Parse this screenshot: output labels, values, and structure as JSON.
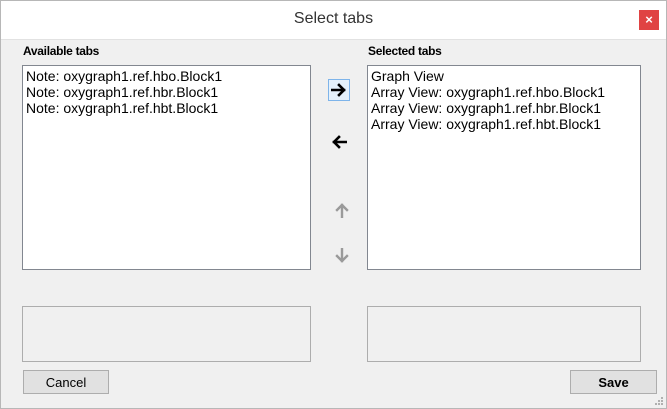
{
  "window": {
    "title": "Select tabs",
    "close_glyph": "×"
  },
  "available": {
    "label": "Available tabs",
    "items": [
      "Note: oxygraph1.ref.hbo.Block1",
      "Note: oxygraph1.ref.hbr.Block1",
      "Note: oxygraph1.ref.hbt.Block1"
    ]
  },
  "selected": {
    "label": "Selected tabs",
    "items": [
      "Graph View",
      "Array View: oxygraph1.ref.hbo.Block1",
      "Array View: oxygraph1.ref.hbr.Block1",
      "Array View: oxygraph1.ref.hbt.Block1"
    ]
  },
  "buttons": {
    "cancel_label": "Cancel",
    "save_label": "Save"
  },
  "icons": {
    "add": "arrow-right-icon",
    "remove": "arrow-left-icon",
    "move_up": "arrow-up-icon",
    "move_down": "arrow-down-icon"
  },
  "colors": {
    "close_button": "#e04343",
    "focus_border": "#7eb4ea",
    "disabled_arrow": "#9a9a9a"
  }
}
